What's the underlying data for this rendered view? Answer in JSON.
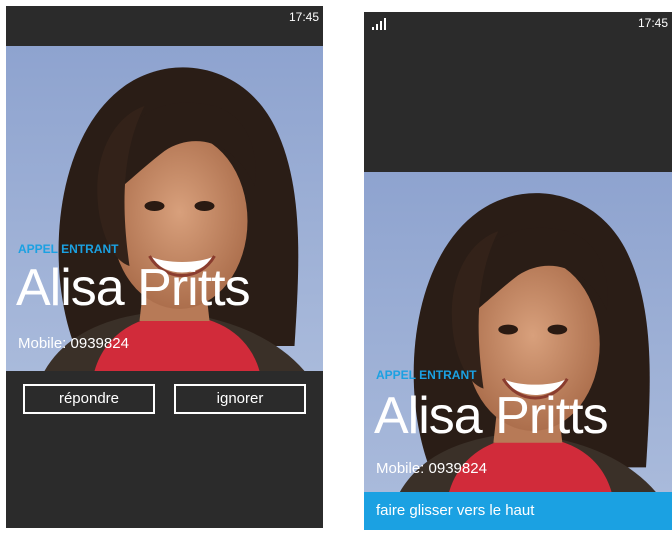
{
  "left_screen": {
    "status_time": "17:45",
    "call_label": "APPEL ENTRANT",
    "caller_name": "Alisa Pritts",
    "caller_number": "Mobile: 0939824",
    "answer_label": "répondre",
    "ignore_label": "ignorer"
  },
  "right_screen": {
    "status_time": "17:45",
    "call_label": "APPEL ENTRANT",
    "caller_name": "Alisa Pritts",
    "caller_number": "Mobile: 0939824",
    "swipe_label": "faire glisser vers le haut"
  },
  "colors": {
    "accent": "#1ba1e2",
    "background": "#2b2b2b",
    "photo_sky": "#8fa6cf",
    "scarf": "#d12b3a"
  },
  "icons": [
    "signal-strength-icon",
    "contact-photo"
  ]
}
